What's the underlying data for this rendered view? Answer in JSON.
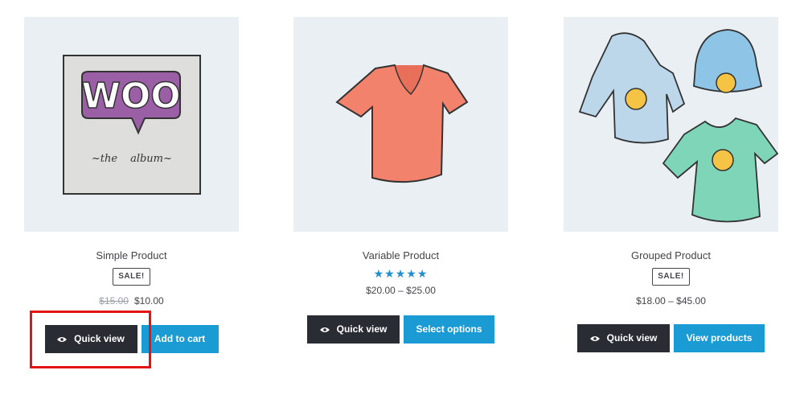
{
  "products": [
    {
      "title": "Simple Product",
      "sale_badge": "SALE!",
      "price_old": "$15.00",
      "price": "$10.00",
      "quick_view_label": "Quick view",
      "action_label": "Add to cart",
      "image_text": {
        "logo": "WOO",
        "caption_the": "~the",
        "caption_album": "album~"
      }
    },
    {
      "title": "Variable Product",
      "rating": "★★★★★",
      "price": "$20.00 – $25.00",
      "quick_view_label": "Quick view",
      "action_label": "Select options"
    },
    {
      "title": "Grouped Product",
      "sale_badge": "SALE!",
      "price": "$18.00 – $45.00",
      "quick_view_label": "Quick view",
      "action_label": "View products"
    }
  ],
  "colors": {
    "dark_button": "#2a2c33",
    "blue_button": "#1a9bd3",
    "highlight": "#e41414",
    "star": "#1f8fcf",
    "thumbnail_bg": "#e9eff3"
  },
  "icons": {
    "quick_view": "eye-icon"
  }
}
